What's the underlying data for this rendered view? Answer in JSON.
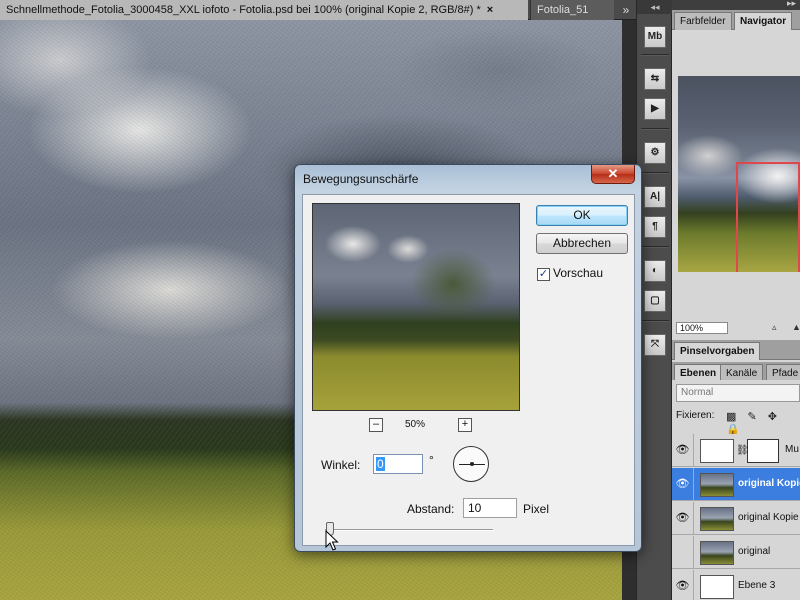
{
  "document_tabs": {
    "active": "Schnellmethode_Fotolia_3000458_XXL iofoto - Fotolia.psd bei 100% (original Kopie 2, RGB/8#) *",
    "active_close": "×",
    "inactive": "Fotolia_51",
    "overflow": "»"
  },
  "icon_dock": {
    "collapse": "◂◂",
    "buttons": [
      "Mb",
      "⇆",
      "▶",
      "⚙",
      "A|",
      "¶",
      "◐",
      "▢",
      "⤧"
    ]
  },
  "panels": {
    "top_glyph": "▸▸",
    "upper_tabs": [
      "Farbfelder",
      "Navigator"
    ],
    "navigator": {
      "zoom": "100%",
      "zoom_out": "▵",
      "zoom_in": "▲"
    },
    "brush_tab": "Pinselvorgaben",
    "layer_tabs": [
      "Ebenen",
      "Kanäle",
      "Pfade"
    ],
    "blend_mode": "Normal",
    "lock_label": "Fixieren:",
    "lock_icons": "▩ ✎ ✥ 🔒",
    "layers": [
      {
        "name": "Mu",
        "visible": true,
        "thumb": "white",
        "mask": true,
        "selected": false
      },
      {
        "name": "original Kopie",
        "visible": true,
        "thumb": "photo",
        "mask": false,
        "selected": true
      },
      {
        "name": "original Kopie",
        "visible": true,
        "thumb": "photo",
        "mask": false,
        "selected": false
      },
      {
        "name": "original",
        "visible": false,
        "thumb": "photo",
        "mask": false,
        "selected": false
      },
      {
        "name": "Ebene 3",
        "visible": true,
        "thumb": "white",
        "mask": false,
        "selected": false
      }
    ],
    "eye_glyph": "👁",
    "link_glyph": "⛓"
  },
  "dialog": {
    "title": "Bewegungsunschärfe",
    "close": "✕",
    "ok": "OK",
    "cancel": "Abbrechen",
    "preview_label": "Vorschau",
    "preview_checked": "✓",
    "zoom_minus": "–",
    "zoom_plus": "+",
    "zoom_level": "50%",
    "angle_label": "Winkel:",
    "angle_value": "0",
    "degree": "°",
    "distance_label": "Abstand:",
    "distance_value": "10",
    "distance_unit": "Pixel",
    "distance_slider_fraction": 0.01
  }
}
